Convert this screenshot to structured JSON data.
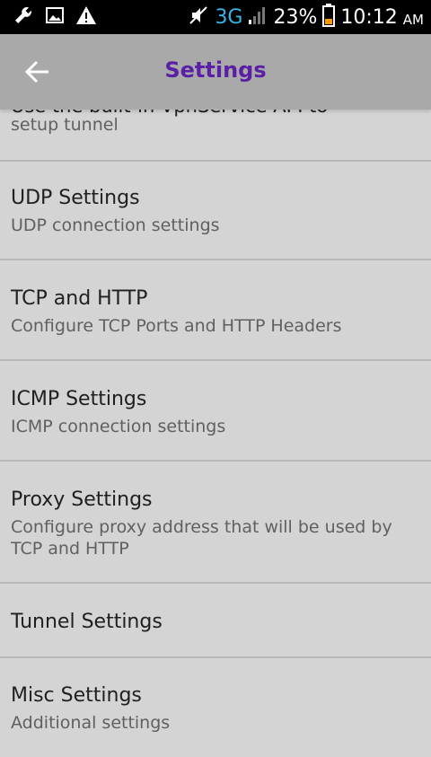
{
  "status_bar": {
    "network": "3G",
    "battery": "23%",
    "time": "10:12",
    "ampm": "AM"
  },
  "app_bar": {
    "title": "Settings"
  },
  "settings": {
    "partial": {
      "title": "Use the built-in VpnService API to",
      "subtitle": "setup tunnel"
    },
    "items": [
      {
        "title": "UDP Settings",
        "subtitle": "UDP connection settings"
      },
      {
        "title": "TCP and HTTP",
        "subtitle": "Configure TCP Ports and HTTP Headers"
      },
      {
        "title": "ICMP Settings",
        "subtitle": "ICMP connection settings"
      },
      {
        "title": "Proxy Settings",
        "subtitle": "Configure proxy address that will be used by TCP and HTTP"
      },
      {
        "title": "Tunnel Settings"
      },
      {
        "title": "Misc Settings",
        "subtitle": "Additional settings"
      }
    ]
  },
  "colors": {
    "accent": "#5a1fa5",
    "appbar": "#a9a9a9",
    "background": "#d4d4d4",
    "network": "#33b5e5"
  }
}
